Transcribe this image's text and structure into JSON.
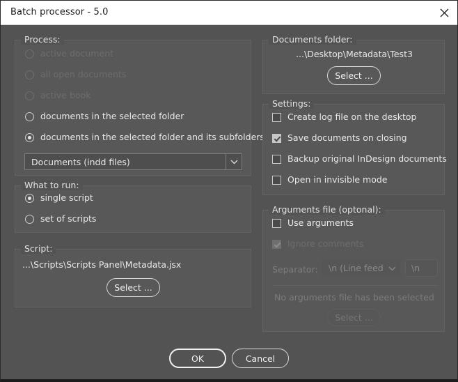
{
  "window": {
    "title": "Batch processor - 5.0",
    "close_icon": "close-icon",
    "background_color": "#535353",
    "titlebar_color": "#ffffff"
  },
  "process_group": {
    "label": "Process:",
    "options": [
      {
        "label": "active document",
        "selected": false,
        "enabled": false
      },
      {
        "label": "all open documents",
        "selected": false,
        "enabled": false
      },
      {
        "label": "active book",
        "selected": false,
        "enabled": false
      },
      {
        "label": "documents in the selected folder",
        "selected": false,
        "enabled": true
      },
      {
        "label": "documents in the selected folder and its subfolders",
        "selected": true,
        "enabled": true
      }
    ],
    "file_type_dropdown": {
      "value": "Documents (indd files)",
      "arrow_icon": "chevron-down-icon"
    }
  },
  "what_to_run_group": {
    "label": "What to run:",
    "options": [
      {
        "label": "single script",
        "selected": true,
        "enabled": true
      },
      {
        "label": "set of scripts",
        "selected": false,
        "enabled": true
      }
    ]
  },
  "script_group": {
    "label": "Script:",
    "path": "...\\Scripts\\Scripts Panel\\Metadata.jsx",
    "select_button": "Select ..."
  },
  "documents_folder_group": {
    "label": "Documents folder:",
    "path": "...\\Desktop\\Metadata\\Test3",
    "select_button": "Select ..."
  },
  "settings_group": {
    "label": "Settings:",
    "options": [
      {
        "label": "Create log file on the desktop",
        "checked": false,
        "enabled": true
      },
      {
        "label": "Save documents on closing",
        "checked": true,
        "enabled": true
      },
      {
        "label": "Backup original InDesign documents",
        "checked": false,
        "enabled": true
      },
      {
        "label": "Open in invisible mode",
        "checked": false,
        "enabled": true
      }
    ]
  },
  "arguments_group": {
    "label": "Arguments file (optonal):",
    "use_arguments": {
      "label": "Use arguments",
      "checked": false,
      "enabled": true
    },
    "ignore_comments": {
      "label": "Ignore comments",
      "checked": true,
      "enabled": false
    },
    "separator_label": "Separator:",
    "separator_dropdown": {
      "value": "\\n (Line feed)",
      "arrow_icon": "chevron-down-icon",
      "enabled": false
    },
    "separator_field": {
      "value": "\\n",
      "enabled": false
    },
    "status_text": "No arguments file has been selected",
    "select_button": "Select ..."
  },
  "footer": {
    "ok_button": "OK",
    "cancel_button": "Cancel"
  }
}
